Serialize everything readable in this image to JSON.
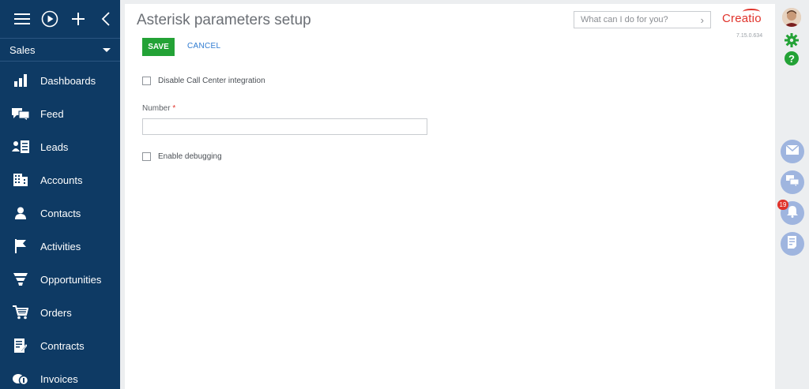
{
  "sidebar": {
    "workspace": "Sales",
    "items": [
      {
        "label": "Dashboards",
        "icon": "dashboards-icon"
      },
      {
        "label": "Feed",
        "icon": "feed-icon"
      },
      {
        "label": "Leads",
        "icon": "leads-icon"
      },
      {
        "label": "Accounts",
        "icon": "accounts-icon"
      },
      {
        "label": "Contacts",
        "icon": "contacts-icon"
      },
      {
        "label": "Activities",
        "icon": "activities-icon"
      },
      {
        "label": "Opportunities",
        "icon": "opportunities-icon"
      },
      {
        "label": "Orders",
        "icon": "orders-icon"
      },
      {
        "label": "Contracts",
        "icon": "contracts-icon"
      },
      {
        "label": "Invoices",
        "icon": "invoices-icon"
      }
    ]
  },
  "page": {
    "title": "Asterisk parameters setup",
    "save_label": "SAVE",
    "cancel_label": "CANCEL",
    "disable_cc_label": "Disable Call Center integration",
    "number_label": "Number",
    "required_mark": "*",
    "number_value": "",
    "debug_label": "Enable debugging"
  },
  "header": {
    "search_placeholder": "What can I do for you?",
    "logo_text": "Creatio",
    "version": "7.15.0.634"
  },
  "rightbar": {
    "notification_count": "19"
  },
  "colors": {
    "sidebar": "#0e3a64",
    "accent_green": "#23a236",
    "link_blue": "#2f7bd1",
    "brand_red": "#e0332b",
    "panel_button": "#9fb5df"
  }
}
